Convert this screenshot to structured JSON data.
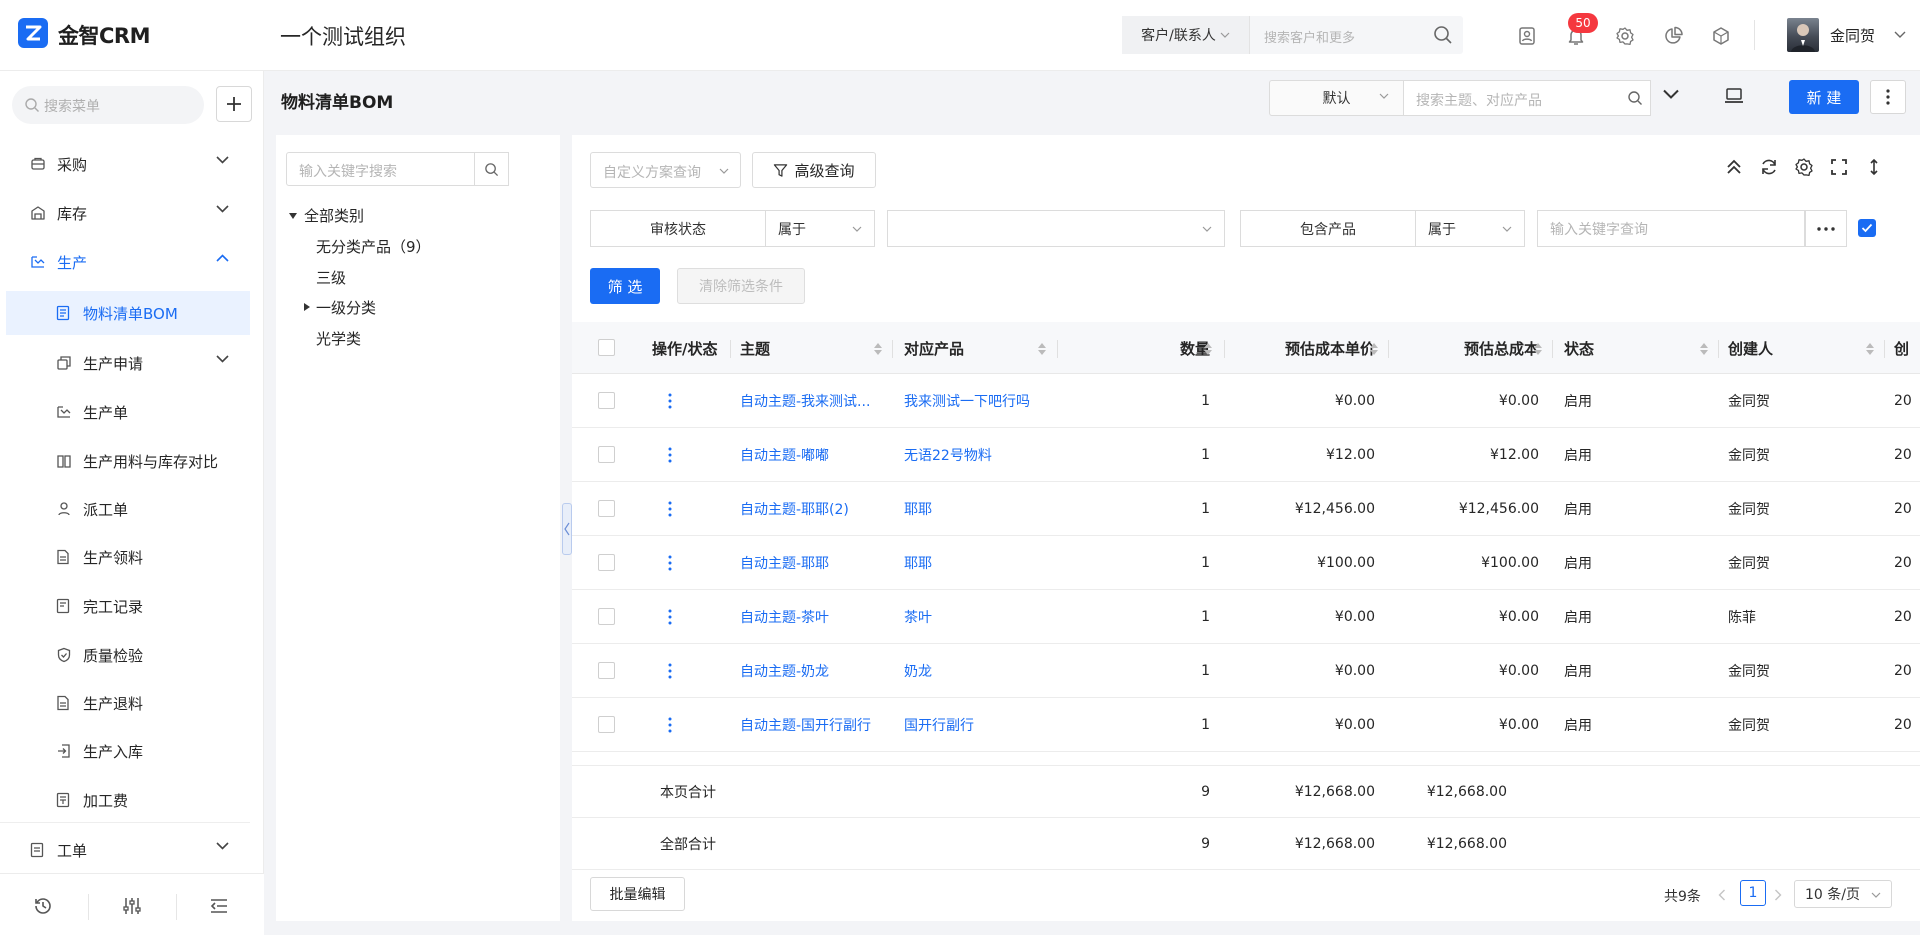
{
  "header": {
    "app_name": "金智CRM",
    "org_name": "一个测试组织",
    "search_scope": "客户/联系人",
    "search_placeholder": "搜索客户和更多",
    "notification_count": "50",
    "user_name": "金同贺",
    "icons": [
      "contact-card-icon",
      "bell-icon",
      "gear-icon",
      "pie-chart-icon",
      "cube-icon"
    ]
  },
  "sidebar": {
    "search_placeholder": "搜索菜单",
    "groups": [
      {
        "label": "采购",
        "icon": "purchase-icon"
      },
      {
        "label": "库存",
        "icon": "warehouse-icon"
      },
      {
        "label": "生产",
        "icon": "production-icon"
      }
    ],
    "production_items": [
      {
        "label": "物料清单BOM",
        "active": true
      },
      {
        "label": "生产申请",
        "expandable": true
      },
      {
        "label": "生产单"
      },
      {
        "label": "生产用料与库存对比"
      },
      {
        "label": "派工单"
      },
      {
        "label": "生产领料"
      },
      {
        "label": "完工记录"
      },
      {
        "label": "质量检验"
      },
      {
        "label": "生产退料"
      },
      {
        "label": "生产入库"
      },
      {
        "label": "加工费"
      }
    ],
    "last_group": {
      "label": "工单",
      "icon": "ticket-icon"
    },
    "accent_color": "#1a6cf3"
  },
  "page": {
    "title": "物料清单BOM",
    "view_select": "默认",
    "search_placeholder": "搜索主题、对应产品",
    "new_label": "新 建"
  },
  "tree": {
    "search_placeholder": "输入关键字搜索",
    "root": "全部类别",
    "nodes": [
      "无分类产品（9）",
      "三级",
      "一级分类",
      "光学类"
    ]
  },
  "filters": {
    "scheme_placeholder": "自定义方案查询",
    "advanced_label": "高级查询",
    "field1": "审核状态",
    "op1": "属于",
    "field2": "包含产品",
    "op2": "属于",
    "keyword_placeholder": "输入关键字查询",
    "filter_label": "筛 选",
    "clear_label": "清除筛选条件"
  },
  "table": {
    "columns": [
      "操作/状态",
      "主题",
      "对应产品",
      "数量",
      "预估成本单价",
      "预估总成本",
      "状态",
      "创建人",
      "创"
    ],
    "rows": [
      {
        "subject": "自动主题-我来测试...",
        "product": "我来测试一下吧行吗",
        "qty": "1",
        "unit": "¥0.00",
        "total": "¥0.00",
        "status": "启用",
        "creator": "金同贺",
        "created": "20"
      },
      {
        "subject": "自动主题-嘟嘟",
        "product": "无语22号物料",
        "qty": "1",
        "unit": "¥12.00",
        "total": "¥12.00",
        "status": "启用",
        "creator": "金同贺",
        "created": "20"
      },
      {
        "subject": "自动主题-耶耶(2)",
        "product": "耶耶",
        "qty": "1",
        "unit": "¥12,456.00",
        "total": "¥12,456.00",
        "status": "启用",
        "creator": "金同贺",
        "created": "20"
      },
      {
        "subject": "自动主题-耶耶",
        "product": "耶耶",
        "qty": "1",
        "unit": "¥100.00",
        "total": "¥100.00",
        "status": "启用",
        "creator": "金同贺",
        "created": "20"
      },
      {
        "subject": "自动主题-茶叶",
        "product": "茶叶",
        "qty": "1",
        "unit": "¥0.00",
        "total": "¥0.00",
        "status": "启用",
        "creator": "陈菲",
        "created": "20"
      },
      {
        "subject": "自动主题-奶龙",
        "product": "奶龙",
        "qty": "1",
        "unit": "¥0.00",
        "total": "¥0.00",
        "status": "启用",
        "creator": "金同贺",
        "created": "20"
      },
      {
        "subject": "自动主题-国开行副行",
        "product": "国开行副行",
        "qty": "1",
        "unit": "¥0.00",
        "total": "¥0.00",
        "status": "启用",
        "creator": "金同贺",
        "created": "20"
      }
    ],
    "page_total": {
      "label": "本页合计",
      "qty": "9",
      "unit": "¥12,668.00",
      "total": "¥12,668.00"
    },
    "all_total": {
      "label": "全部合计",
      "qty": "9",
      "unit": "¥12,668.00",
      "total": "¥12,668.00"
    }
  },
  "footer": {
    "batch_edit": "批量编辑",
    "total_text": "共9条",
    "current_page": "1",
    "page_size": "10 条/页"
  }
}
